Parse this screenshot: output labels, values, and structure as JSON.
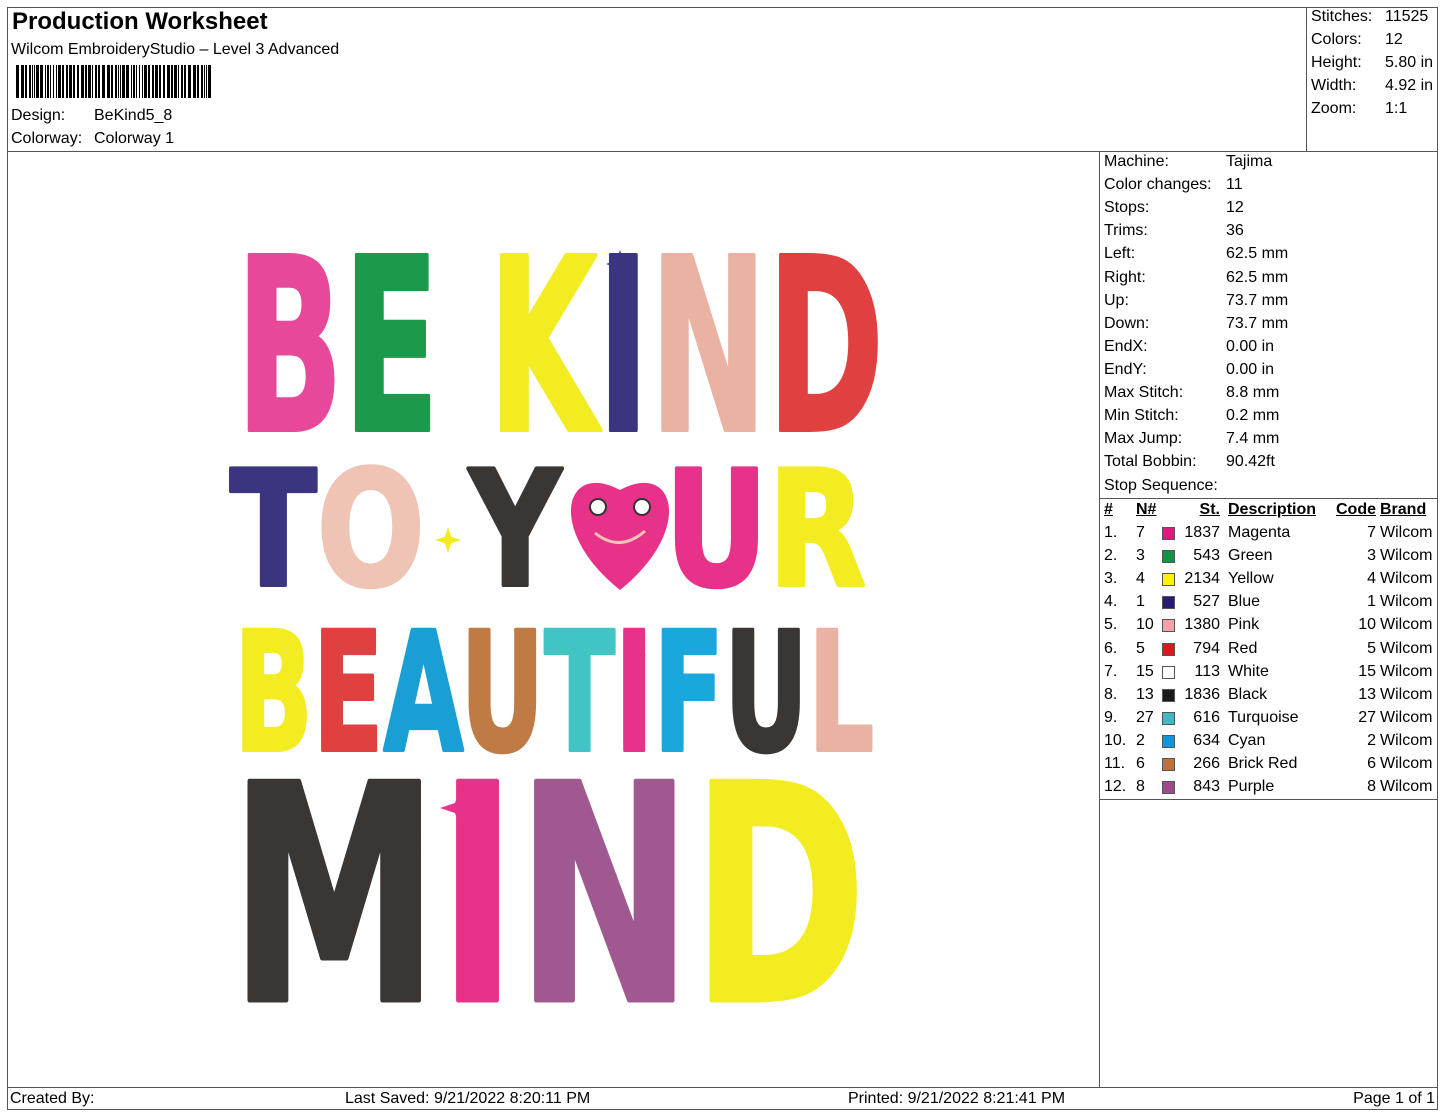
{
  "header": {
    "title": "Production Worksheet",
    "subtitle": "Wilcom EmbroideryStudio – Level 3 Advanced",
    "design_label": "Design:",
    "design_value": "BeKind5_8",
    "colorway_label": "Colorway:",
    "colorway_value": "Colorway 1"
  },
  "stats": [
    {
      "label": "Stitches:",
      "value": "11525"
    },
    {
      "label": "Colors:",
      "value": "12"
    },
    {
      "label": "Height:",
      "value": "5.80 in"
    },
    {
      "label": "Width:",
      "value": "4.92 in"
    },
    {
      "label": "Zoom:",
      "value": "1:1"
    }
  ],
  "info": [
    {
      "label": "Machine:",
      "value": "Tajima"
    },
    {
      "label": "Color changes:",
      "value": "11"
    },
    {
      "label": "Stops:",
      "value": "12"
    },
    {
      "label": "Trims:",
      "value": "36"
    },
    {
      "label": "Left:",
      "value": "62.5 mm"
    },
    {
      "label": "Right:",
      "value": "62.5 mm"
    },
    {
      "label": "Up:",
      "value": "73.7 mm"
    },
    {
      "label": "Down:",
      "value": "73.7 mm"
    },
    {
      "label": "EndX:",
      "value": "0.00 in"
    },
    {
      "label": "EndY:",
      "value": "0.00 in"
    },
    {
      "label": "Max Stitch:",
      "value": "8.8 mm"
    },
    {
      "label": "Min Stitch:",
      "value": "0.2 mm"
    },
    {
      "label": "Max Jump:",
      "value": "7.4 mm"
    },
    {
      "label": "Total Bobbin:",
      "value": "90.42ft"
    }
  ],
  "stop_sequence": {
    "label": "Stop Sequence:",
    "headers": {
      "num": "#",
      "needle": "N#",
      "stitches": "St.",
      "description": "Description",
      "code": "Code",
      "brand": "Brand"
    },
    "rows": [
      {
        "num": "1.",
        "needle": "7",
        "color": "#e0177f",
        "stitches": "1837",
        "description": "Magenta",
        "code": "7",
        "brand": "Wilcom"
      },
      {
        "num": "2.",
        "needle": "3",
        "color": "#0f9447",
        "stitches": "543",
        "description": "Green",
        "code": "3",
        "brand": "Wilcom"
      },
      {
        "num": "3.",
        "needle": "4",
        "color": "#fff200",
        "stitches": "2134",
        "description": "Yellow",
        "code": "4",
        "brand": "Wilcom"
      },
      {
        "num": "4.",
        "needle": "1",
        "color": "#2a1a78",
        "stitches": "527",
        "description": "Blue",
        "code": "1",
        "brand": "Wilcom"
      },
      {
        "num": "5.",
        "needle": "10",
        "color": "#f3a3a8",
        "stitches": "1380",
        "description": "Pink",
        "code": "10",
        "brand": "Wilcom"
      },
      {
        "num": "6.",
        "needle": "5",
        "color": "#e0161f",
        "stitches": "794",
        "description": "Red",
        "code": "5",
        "brand": "Wilcom"
      },
      {
        "num": "7.",
        "needle": "15",
        "color": "#ffffff",
        "stitches": "113",
        "description": "White",
        "code": "15",
        "brand": "Wilcom"
      },
      {
        "num": "8.",
        "needle": "13",
        "color": "#1e1a1a",
        "stitches": "1836",
        "description": "Black",
        "code": "13",
        "brand": "Wilcom"
      },
      {
        "num": "9.",
        "needle": "27",
        "color": "#3bbcc4",
        "stitches": "616",
        "description": "Turquoise",
        "code": "27",
        "brand": "Wilcom"
      },
      {
        "num": "10.",
        "needle": "2",
        "color": "#0f95e0",
        "stitches": "634",
        "description": "Cyan",
        "code": "2",
        "brand": "Wilcom"
      },
      {
        "num": "11.",
        "needle": "6",
        "color": "#c0703c",
        "stitches": "266",
        "description": "Brick Red",
        "code": "6",
        "brand": "Wilcom"
      },
      {
        "num": "12.",
        "needle": "8",
        "color": "#9a4b8a",
        "stitches": "843",
        "description": "Purple",
        "code": "8",
        "brand": "Wilcom"
      }
    ]
  },
  "artwork": {
    "lines": [
      "BE KIND",
      "TO YOUR",
      "BEAUTIFUL",
      "MIND"
    ],
    "letter_colors": [
      [
        "#e8489a",
        "#1a9a4a",
        "#f2ec20",
        "#3b3580",
        "#eab2a2",
        "#e04040"
      ],
      [
        "#3b3580",
        "#f0c4b4",
        "#3a3634",
        "#e8328a",
        "#f2ec20",
        "#40c0c4"
      ],
      [
        "#f2ec20",
        "#e04040",
        "#1a9fd4",
        "#c07a44",
        "#40c4c4",
        "#e8328a",
        "#1aa8dc",
        "#3a3634",
        "#eab2a2"
      ],
      [
        "#3a3634",
        "#e8328a",
        "#a05890",
        "#f2ec20"
      ]
    ]
  },
  "footer": {
    "created_by": "Created By:",
    "last_saved": "Last Saved: 9/21/2022 8:20:11 PM",
    "printed": "Printed: 9/21/2022 8:21:41 PM",
    "page": "Page 1 of 1"
  }
}
